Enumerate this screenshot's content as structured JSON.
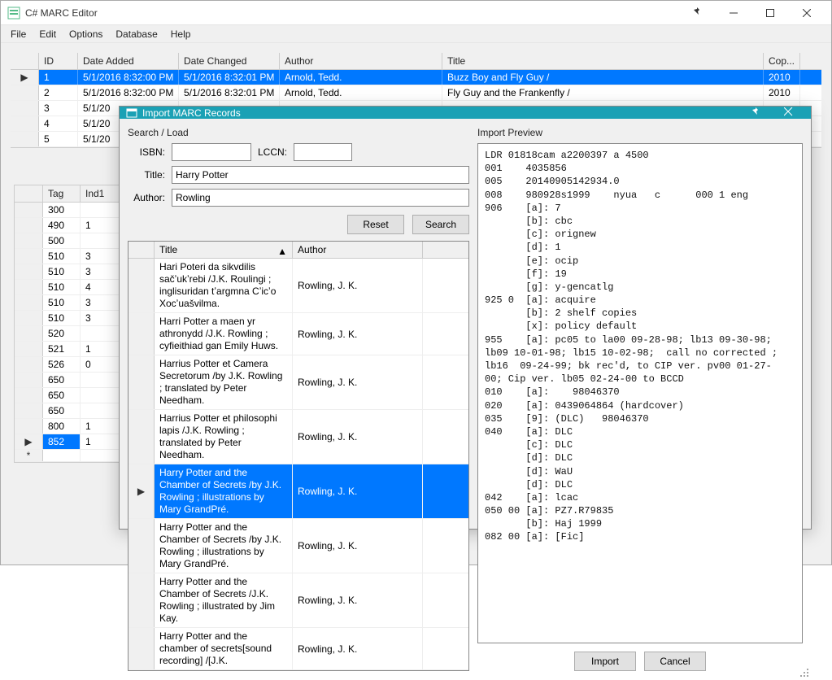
{
  "window": {
    "title": "C# MARC Editor",
    "menus": [
      "File",
      "Edit",
      "Options",
      "Database",
      "Help"
    ]
  },
  "records_grid": {
    "headers": [
      "ID",
      "Date Added",
      "Date Changed",
      "Author",
      "Title",
      "Cop..."
    ],
    "rows": [
      {
        "id": "1",
        "added": "5/1/2016 8:32:00 PM",
        "changed": "5/1/2016 8:32:01 PM",
        "author": "Arnold, Tedd.",
        "title": "Buzz Boy and Fly Guy /",
        "cop": "2010",
        "selected": true,
        "indicator": "▶"
      },
      {
        "id": "2",
        "added": "5/1/2016 8:32:00 PM",
        "changed": "5/1/2016 8:32:01 PM",
        "author": "Arnold, Tedd.",
        "title": "Fly Guy and the Frankenfly /",
        "cop": "2010"
      },
      {
        "id": "3",
        "added": "5/1/20",
        "changed": "",
        "author": "",
        "title": "",
        "cop": ""
      },
      {
        "id": "4",
        "added": "5/1/20",
        "changed": "",
        "author": "",
        "title": "",
        "cop": ""
      },
      {
        "id": "5",
        "added": "5/1/20",
        "changed": "",
        "author": "",
        "title": "",
        "cop": ""
      }
    ]
  },
  "tags_grid": {
    "headers": [
      "Tag",
      "Ind1"
    ],
    "rows": [
      {
        "tag": "300",
        "ind1": ""
      },
      {
        "tag": "490",
        "ind1": "1"
      },
      {
        "tag": "500",
        "ind1": ""
      },
      {
        "tag": "510",
        "ind1": "3"
      },
      {
        "tag": "510",
        "ind1": "3"
      },
      {
        "tag": "510",
        "ind1": "4"
      },
      {
        "tag": "510",
        "ind1": "3"
      },
      {
        "tag": "510",
        "ind1": "3"
      },
      {
        "tag": "520",
        "ind1": ""
      },
      {
        "tag": "521",
        "ind1": "1"
      },
      {
        "tag": "526",
        "ind1": "0"
      },
      {
        "tag": "650",
        "ind1": ""
      },
      {
        "tag": "650",
        "ind1": ""
      },
      {
        "tag": "650",
        "ind1": ""
      },
      {
        "tag": "800",
        "ind1": "1"
      },
      {
        "tag": "852",
        "ind1": "1",
        "selected": true,
        "indicator": "▶"
      },
      {
        "tag": "",
        "ind1": "",
        "indicator": "*"
      }
    ]
  },
  "dialog": {
    "title": "Import MARC Records",
    "search_load_label": "Search / Load",
    "labels": {
      "isbn": "ISBN:",
      "lccn": "LCCN:",
      "title": "Title:",
      "author": "Author:"
    },
    "inputs": {
      "isbn": "",
      "lccn": "",
      "title": "Harry Potter",
      "author": "Rowling"
    },
    "buttons": {
      "reset": "Reset",
      "search": "Search",
      "import": "Import",
      "cancel": "Cancel"
    },
    "results_headers": [
      "Title",
      "Author"
    ],
    "results": [
      {
        "title": "Hari Poteri da sikvdilis sačʼukʼrebi /J.K. Roulingi ; inglisuridan tʼargmna Cʼicʼo Xocʼuašvilma.",
        "author": "Rowling, J. K."
      },
      {
        "title": "Harri Potter a maen yr athronydd /J.K. Rowling ; cyfieithiad gan Emily Huws.",
        "author": "Rowling, J. K."
      },
      {
        "title": "Harrius Potter et Camera Secretorum /by J.K. Rowling ; translated by Peter Needham.",
        "author": "Rowling, J. K."
      },
      {
        "title": "Harrius Potter et philosophi lapis /J.K. Rowling ; translated by Peter Needham.",
        "author": "Rowling, J. K."
      },
      {
        "title": "Harry Potter and the Chamber of Secrets /by J.K. Rowling ; illustrations by Mary GrandPré.",
        "author": "Rowling, J. K.",
        "selected": true,
        "indicator": "▶"
      },
      {
        "title": "Harry Potter and the Chamber of Secrets /by J.K. Rowling ; illustrations by Mary GrandPré.",
        "author": "Rowling, J. K."
      },
      {
        "title": "Harry Potter and the Chamber of Secrets /J.K. Rowling ; illustrated by Jim Kay.",
        "author": "Rowling, J. K."
      },
      {
        "title": "Harry Potter and the chamber of secrets[sound recording] /[J.K.",
        "author": "Rowling, J. K."
      }
    ],
    "preview_label": "Import Preview",
    "preview_text": "LDR 01818cam a2200397 a 4500\n001    4035856\n005    20140905142934.0\n008    980928s1999    nyua   c      000 1 eng  \n906    [a]: 7\n       [b]: cbc\n       [c]: orignew\n       [d]: 1\n       [e]: ocip\n       [f]: 19\n       [g]: y-gencatlg\n925 0  [a]: acquire\n       [b]: 2 shelf copies\n       [x]: policy default\n955    [a]: pc05 to la00 09-28-98; lb13 09-30-98;\nlb09 10-01-98; lb15 10-02-98;  call no corrected ;\nlb16  09-24-99; bk rec'd, to CIP ver. pv00 01-27-\n00; Cip ver. lb05 02-24-00 to BCCD\n010    [a]:    98046370\n020    [a]: 0439064864 (hardcover)\n035    [9]: (DLC)   98046370\n040    [a]: DLC\n       [c]: DLC\n       [d]: DLC\n       [d]: WaU\n       [d]: DLC\n042    [a]: lcac\n050 00 [a]: PZ7.R79835\n       [b]: Haj 1999\n082 00 [a]: [Fic]"
  }
}
